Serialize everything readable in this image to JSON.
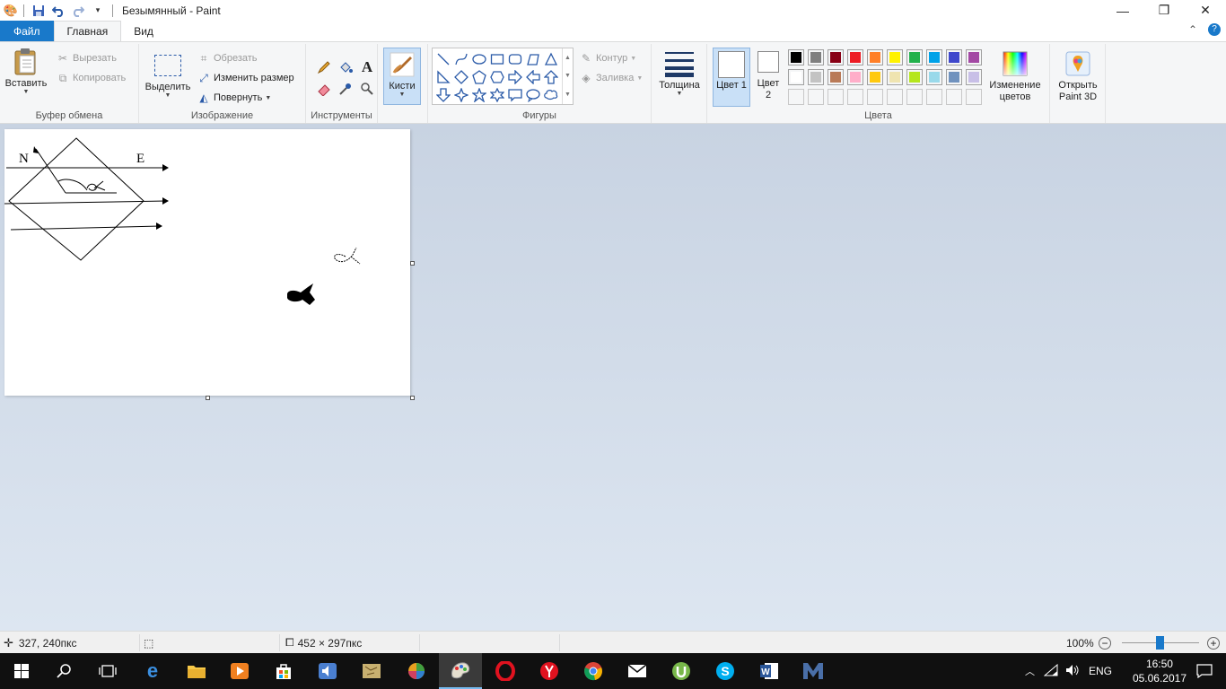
{
  "titlebar": {
    "title": "Безымянный - Paint",
    "buttons": {
      "minimize": "—",
      "maximize": "❐",
      "close": "✕"
    }
  },
  "tabs": {
    "file": "Файл",
    "home": "Главная",
    "view": "Вид"
  },
  "ribbon": {
    "clipboard": {
      "label": "Буфер обмена",
      "paste": "Вставить",
      "cut": "Вырезать",
      "copy": "Копировать"
    },
    "image": {
      "label": "Изображение",
      "select": "Выделить",
      "crop": "Обрезать",
      "resize": "Изменить размер",
      "rotate": "Повернуть"
    },
    "tools": {
      "label": "Инструменты"
    },
    "brushes": {
      "label": "Кисти"
    },
    "shapes": {
      "label": "Фигуры",
      "outline": "Контур",
      "fill": "Заливка"
    },
    "size": {
      "label": "Толщина"
    },
    "colors": {
      "label": "Цвета",
      "color1": "Цвет 1",
      "color2": "Цвет 2",
      "edit": "Изменение цветов",
      "palette_row1": [
        "#000000",
        "#7f7f7f",
        "#880015",
        "#ed1c24",
        "#ff7f27",
        "#fff200",
        "#22b14c",
        "#00a2e8",
        "#3f48cc",
        "#a349a4"
      ],
      "palette_row2": [
        "#ffffff",
        "#c3c3c3",
        "#b97a57",
        "#ffaec9",
        "#ffc90e",
        "#efe4b0",
        "#b5e61d",
        "#99d9ea",
        "#7092be",
        "#c8bfe7"
      ]
    },
    "paint3d": {
      "label": "Открыть Paint 3D"
    }
  },
  "canvas": {
    "label_n": "N",
    "label_e": "E"
  },
  "statusbar": {
    "cursor_pos": "327, 240пкс",
    "selection_size": "",
    "image_size": "452 × 297пкс",
    "zoom": "100%"
  },
  "taskbar": {
    "lang": "ENG",
    "time": "16:50",
    "date": "05.06.2017"
  }
}
